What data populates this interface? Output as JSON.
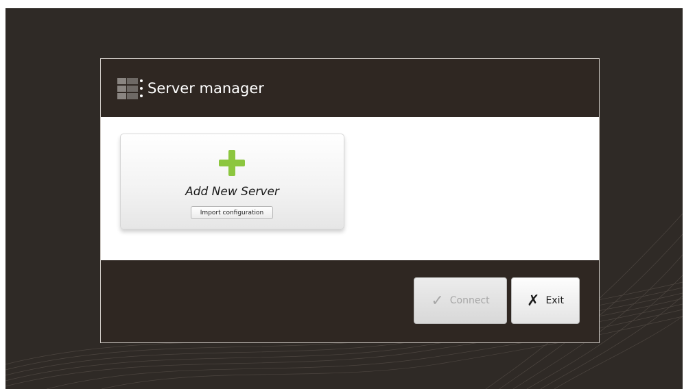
{
  "dialog": {
    "title": "Server manager",
    "icon": "server-list-icon"
  },
  "add_card": {
    "icon": "plus-icon",
    "label": "Add New Server",
    "import_label": "Import configuration"
  },
  "footer": {
    "connect": {
      "icon": "checkmark-icon",
      "glyph": "✓",
      "label": "Connect",
      "enabled": false
    },
    "exit": {
      "icon": "x-icon",
      "glyph": "✗",
      "label": "Exit",
      "enabled": true
    }
  },
  "colors": {
    "background": "#2f2a26",
    "panel": "#2f2722",
    "accent_plus": "#8cc63f"
  }
}
